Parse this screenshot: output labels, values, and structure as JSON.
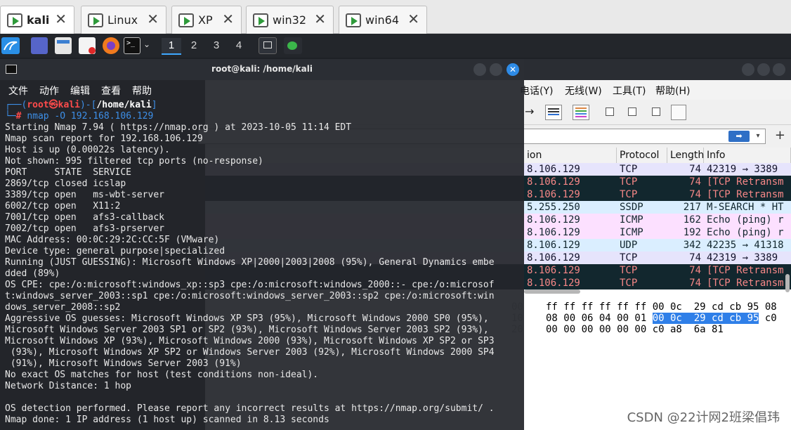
{
  "vm_tabs": [
    {
      "label": "kali",
      "active": true,
      "close": "✕"
    },
    {
      "label": "Linux",
      "close": "✕"
    },
    {
      "label": "XP",
      "close": "✕"
    },
    {
      "label": "win32",
      "close": "✕"
    },
    {
      "label": "win64",
      "close": "✕"
    }
  ],
  "panel": {
    "workspaces": [
      "1",
      "2",
      "3",
      "4"
    ],
    "active_workspace": "1"
  },
  "terminal": {
    "title": "root@kali: /home/kali",
    "close_icon": "✕",
    "menu": [
      "文件",
      "动作",
      "编辑",
      "查看",
      "帮助"
    ],
    "prompt": {
      "line1_pre": "┌──(",
      "user": "root㉿kali",
      "line1_mid": ")-[",
      "path": "/home/kali",
      "line1_post": "]",
      "line2_pre": "└─",
      "hash": "#",
      "command": "nmap -O 192.168.106.129"
    },
    "output": [
      "Starting Nmap 7.94 ( https://nmap.org ) at 2023-10-05 11:14 EDT",
      "Nmap scan report for 192.168.106.129",
      "Host is up (0.00022s latency).",
      "Not shown: 995 filtered tcp ports (no-response)",
      "PORT     STATE  SERVICE",
      "2869/tcp closed icslap",
      "3389/tcp open   ms-wbt-server",
      "6002/tcp open   X11:2",
      "7001/tcp open   afs3-callback",
      "7002/tcp open   afs3-prserver",
      "MAC Address: 00:0C:29:2C:CC:5F (VMware)",
      "Device type: general purpose|specialized",
      "Running (JUST GUESSING): Microsoft Windows XP|2000|2003|2008 (95%), General Dynamics embe",
      "dded (89%)",
      "OS CPE: cpe:/o:microsoft:windows_xp::sp3 cpe:/o:microsoft:windows_2000::- cpe:/o:microsof",
      "t:windows_server_2003::sp1 cpe:/o:microsoft:windows_server_2003::sp2 cpe:/o:microsoft:win",
      "dows_server_2008::sp2",
      "Aggressive OS guesses: Microsoft Windows XP SP3 (95%), Microsoft Windows 2000 SP0 (95%),",
      "Microsoft Windows Server 2003 SP1 or SP2 (93%), Microsoft Windows Server 2003 SP2 (93%),",
      "Microsoft Windows XP (93%), Microsoft Windows 2000 (93%), Microsoft Windows XP SP2 or SP3",
      " (93%), Microsoft Windows XP SP2 or Windows Server 2003 (92%), Microsoft Windows 2000 SP4",
      " (91%), Microsoft Windows Server 2003 (91%)",
      "No exact OS matches for host (test conditions non-ideal).",
      "Network Distance: 1 hop",
      "",
      "OS detection performed. Please report any incorrect results at https://nmap.org/submit/ .",
      "Nmap done: 1 IP address (1 host up) scanned in 8.13 seconds"
    ]
  },
  "wireshark": {
    "menu": [
      "电话(Y)",
      "无线(W)",
      "工具(T)",
      "帮助(H)"
    ],
    "columns": [
      "ion",
      "Protocol",
      "Length",
      "Info"
    ],
    "rows": [
      {
        "dest": "8.106.129",
        "proto": "TCP",
        "len": "74",
        "info": "42319 → 3389",
        "bg": "#e6e4fc",
        "fg": "#12122a"
      },
      {
        "dest": "8.106.129",
        "proto": "TCP",
        "len": "74",
        "info": "[TCP Retransm",
        "bg": "#12272e",
        "fg": "#f78787"
      },
      {
        "dest": "8.106.129",
        "proto": "TCP",
        "len": "74",
        "info": "[TCP Retransm",
        "bg": "#12272e",
        "fg": "#f78787"
      },
      {
        "dest": "5.255.250",
        "proto": "SSDP",
        "len": "217",
        "info": "M-SEARCH * HT",
        "bg": "#daeeff",
        "fg": "#12272e"
      },
      {
        "dest": "8.106.129",
        "proto": "ICMP",
        "len": "162",
        "info": "Echo (ping) r",
        "bg": "#fce0ff",
        "fg": "#12272e"
      },
      {
        "dest": "8.106.129",
        "proto": "ICMP",
        "len": "192",
        "info": "Echo (ping) r",
        "bg": "#fce0ff",
        "fg": "#12272e"
      },
      {
        "dest": "8.106.129",
        "proto": "UDP",
        "len": "342",
        "info": "42235 → 41318",
        "bg": "#daeeff",
        "fg": "#12272e"
      },
      {
        "dest": "8.106.129",
        "proto": "TCP",
        "len": "74",
        "info": "42319 → 3389",
        "bg": "#e6e4fc",
        "fg": "#12122a"
      },
      {
        "dest": "8.106.129",
        "proto": "TCP",
        "len": "74",
        "info": "[TCP Retransm",
        "bg": "#12272e",
        "fg": "#f78787"
      },
      {
        "dest": "8.106.129",
        "proto": "TCP",
        "len": "74",
        "info": "[TCP Retransm",
        "bg": "#12272e",
        "fg": "#f78787"
      }
    ],
    "hex": {
      "offsets": [
        "00",
        "10",
        "20"
      ],
      "line1": "ff ff ff ff ff ff 00 0c  29 cd cb 95 08",
      "line2_pre": "08 00 06 04 00 01 ",
      "line2_hl": "00 0c  29 cd cb 95",
      "line2_post": " c0",
      "line3": "00 00 00 00 00 00 c0 a8  6a 81"
    }
  },
  "watermark": "CSDN @22计网2班梁倡玮"
}
